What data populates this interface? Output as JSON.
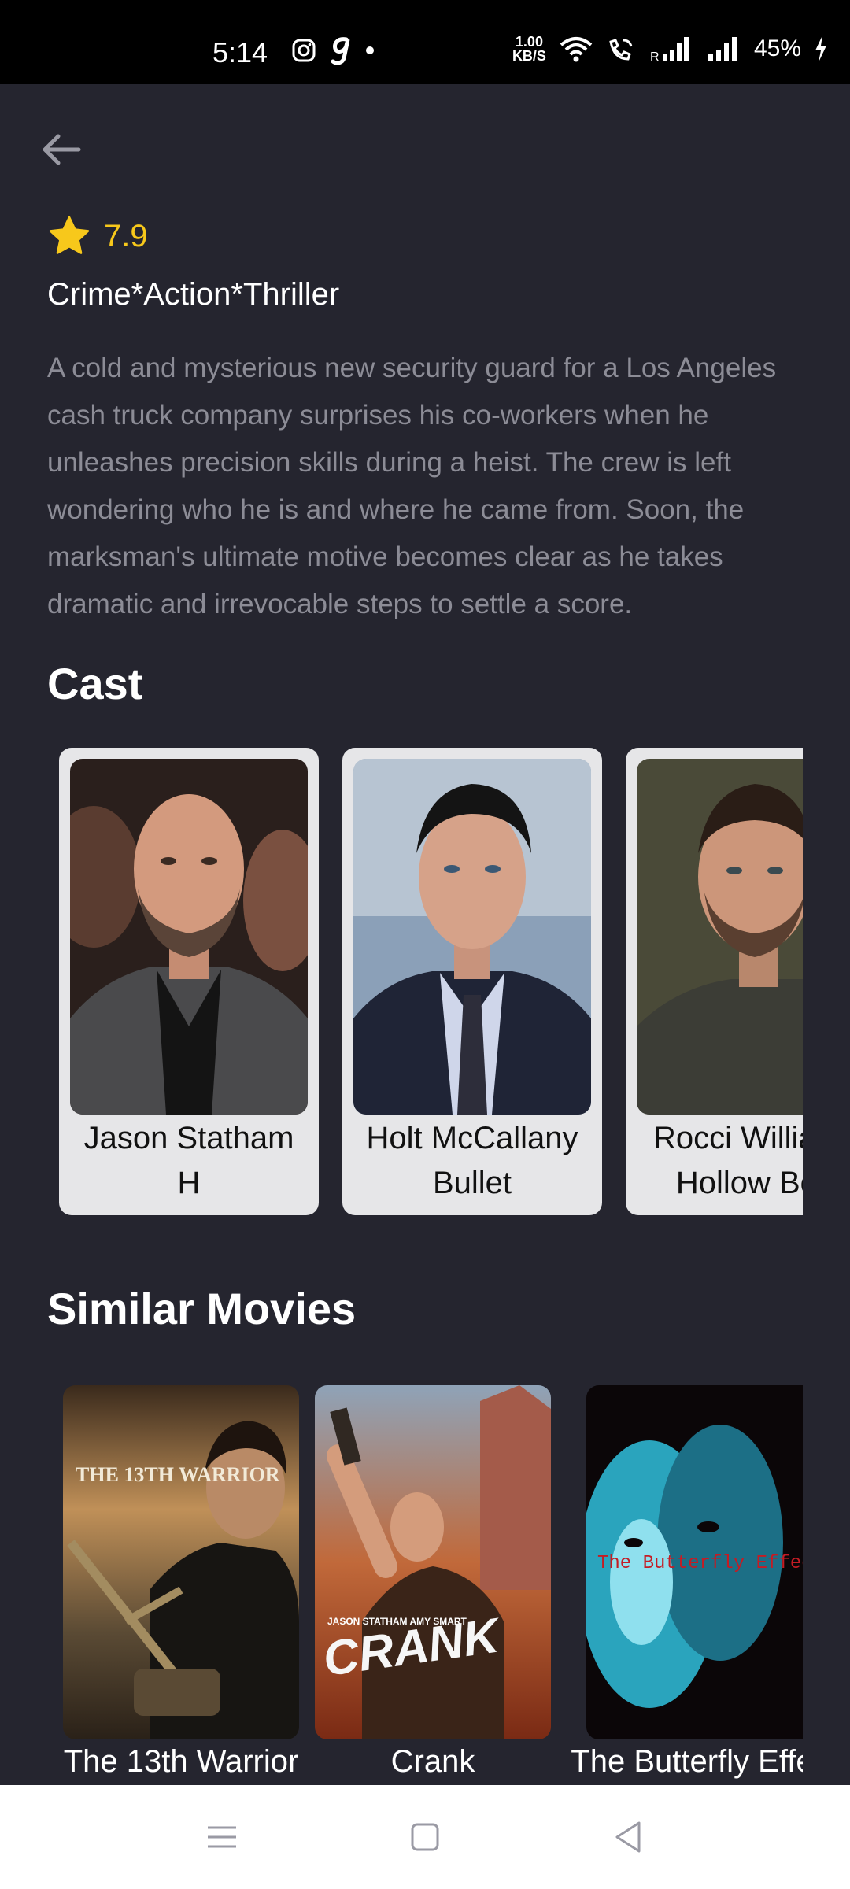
{
  "status_bar": {
    "time": "5:14",
    "speed_value": "1.00",
    "speed_unit": "KB/S",
    "battery": "45%"
  },
  "movie": {
    "rating": "7.9",
    "genres": "Crime*Action*Thriller",
    "overview": "A cold and mysterious new security guard for a Los Angeles cash truck company surprises his co-workers when he unleashes precision skills during a heist. The crew is left wondering who he is and where he came from. Soon, the marksman's ultimate motive becomes clear as he takes dramatic and irrevocable steps to settle a score."
  },
  "cast_section": {
    "title": "Cast",
    "items": [
      {
        "name": "Jason Statham",
        "role": "H"
      },
      {
        "name": "Holt McCallany",
        "role": "Bullet"
      },
      {
        "name": "Rocci Williams",
        "role": "Hollow Bob"
      }
    ]
  },
  "similar_section": {
    "title": "Similar Movies",
    "items": [
      {
        "title": "The 13th Warrior",
        "poster_text": "THE 13TH WARRIOR"
      },
      {
        "title": "Crank",
        "poster_text": "CRANK",
        "poster_credits": "JASON STATHAM   AMY SMART"
      },
      {
        "title": "The Butterfly Effect",
        "poster_text": "The Butterfly Effect"
      }
    ]
  },
  "colors": {
    "background": "#25252f",
    "accent_star": "#f7c81b",
    "card": "#e6e6e8"
  },
  "icons": {
    "back": "arrow-left-icon",
    "star": "star-icon",
    "nav_menu": "menu-icon",
    "nav_home": "square-icon",
    "nav_back": "triangle-back-icon"
  }
}
